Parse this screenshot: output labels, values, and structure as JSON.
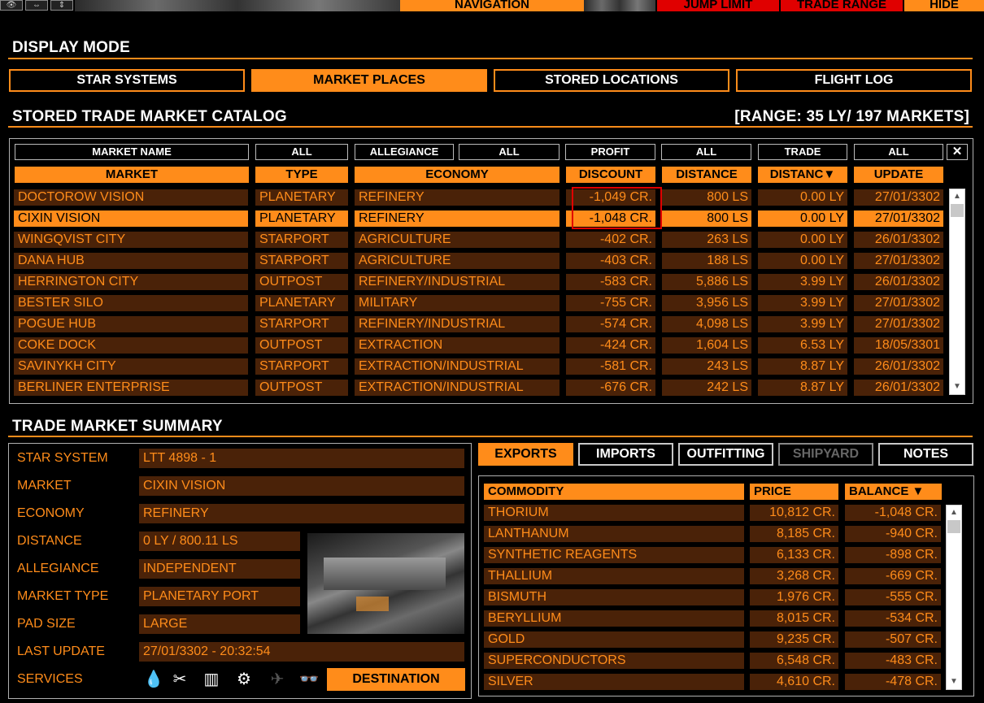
{
  "topbar": {
    "icons": [
      "eye-icon",
      "horizontal-arrows-icon",
      "vertical-arrows-icon"
    ],
    "navigation": "NAVIGATION",
    "jump_limit": "JUMP LIMIT",
    "trade_range": "TRADE RANGE",
    "hide": "HIDE"
  },
  "display_mode": {
    "title": "DISPLAY MODE",
    "buttons": [
      "STAR SYSTEMS",
      "MARKET PLACES",
      "STORED LOCATIONS",
      "FLIGHT LOG"
    ],
    "active": "MARKET PLACES"
  },
  "catalog": {
    "title": "STORED TRADE MARKET CATALOG",
    "range": "[RANGE: 35 LY/ 197 MARKETS]",
    "filters": {
      "market_name": "MARKET NAME",
      "type": "ALL",
      "allegiance_label": "ALLEGIANCE",
      "allegiance": "ALL",
      "profit_label": "PROFIT",
      "profit": "ALL",
      "trade_label": "TRADE",
      "trade": "ALL",
      "clear": "✕"
    },
    "columns": [
      "MARKET",
      "TYPE",
      "ECONOMY",
      "DISCOUNT",
      "DISTANCE",
      "DISTANC▼",
      "UPDATE"
    ],
    "rows": [
      {
        "market": "DOCTOROW VISION",
        "type": "PLANETARY",
        "economy": "REFINERY",
        "discount": "-1,049 CR.",
        "distance": "800 LS",
        "ly": "0.00 LY",
        "update": "27/01/3302"
      },
      {
        "market": "CIXIN VISION",
        "type": "PLANETARY",
        "economy": "REFINERY",
        "discount": "-1,048 CR.",
        "distance": "800 LS",
        "ly": "0.00 LY",
        "update": "27/01/3302"
      },
      {
        "market": "WINGQVIST CITY",
        "type": "STARPORT",
        "economy": "AGRICULTURE",
        "discount": "-402 CR.",
        "distance": "263 LS",
        "ly": "0.00 LY",
        "update": "26/01/3302"
      },
      {
        "market": "DANA HUB",
        "type": "STARPORT",
        "economy": "AGRICULTURE",
        "discount": "-403 CR.",
        "distance": "188 LS",
        "ly": "0.00 LY",
        "update": "27/01/3302"
      },
      {
        "market": "HERRINGTON CITY",
        "type": "OUTPOST",
        "economy": "REFINERY/INDUSTRIAL",
        "discount": "-583 CR.",
        "distance": "5,886 LS",
        "ly": "3.99 LY",
        "update": "26/01/3302"
      },
      {
        "market": "BESTER SILO",
        "type": "PLANETARY",
        "economy": "MILITARY",
        "discount": "-755 CR.",
        "distance": "3,956 LS",
        "ly": "3.99 LY",
        "update": "27/01/3302"
      },
      {
        "market": "POGUE HUB",
        "type": "STARPORT",
        "economy": "REFINERY/INDUSTRIAL",
        "discount": "-574 CR.",
        "distance": "4,098 LS",
        "ly": "3.99 LY",
        "update": "27/01/3302"
      },
      {
        "market": "COKE DOCK",
        "type": "OUTPOST",
        "economy": "EXTRACTION",
        "discount": "-424 CR.",
        "distance": "1,604 LS",
        "ly": "6.53 LY",
        "update": "18/05/3301"
      },
      {
        "market": "SAVINYKH CITY",
        "type": "STARPORT",
        "economy": "EXTRACTION/INDUSTRIAL",
        "discount": "-581 CR.",
        "distance": "243 LS",
        "ly": "8.87 LY",
        "update": "26/01/3302"
      },
      {
        "market": "BERLINER ENTERPRISE",
        "type": "OUTPOST",
        "economy": "EXTRACTION/INDUSTRIAL",
        "discount": "-676 CR.",
        "distance": "242 LS",
        "ly": "8.87 LY",
        "update": "26/01/3302"
      }
    ],
    "selected_index": 1,
    "highlight_color": "#e00000"
  },
  "summary": {
    "title": "TRADE MARKET SUMMARY",
    "fields": [
      {
        "label": "STAR SYSTEM",
        "value": "LTT 4898 - 1"
      },
      {
        "label": "MARKET",
        "value": "CIXIN VISION"
      },
      {
        "label": "ECONOMY",
        "value": "REFINERY"
      },
      {
        "label": "DISTANCE",
        "value": "0 LY / 800.11 LS"
      },
      {
        "label": "ALLEGIANCE",
        "value": "INDEPENDENT"
      },
      {
        "label": "MARKET TYPE",
        "value": "PLANETARY PORT"
      },
      {
        "label": "PAD SIZE",
        "value": "LARGE"
      },
      {
        "label": "LAST UPDATE",
        "value": "27/01/3302 - 20:32:54"
      },
      {
        "label": "SERVICES",
        "value": ""
      }
    ],
    "services_icons": [
      "refuel-drop-icon",
      "repair-tools-icon",
      "black-market-icon",
      "outfitting-gear-icon",
      "shipyard-ship-icon",
      "disguise-glasses-icon"
    ],
    "destination": "DESTINATION",
    "image": "station-image"
  },
  "tabs": {
    "labels": [
      "EXPORTS",
      "IMPORTS",
      "OUTFITTING",
      "SHIPYARD",
      "NOTES"
    ],
    "active": "EXPORTS",
    "disabled": "SHIPYARD"
  },
  "commodities": {
    "columns": [
      "COMMODITY",
      "PRICE",
      "BALANCE ▼"
    ],
    "rows": [
      {
        "name": "THORIUM",
        "price": "10,812 CR.",
        "balance": "-1,048 CR."
      },
      {
        "name": "LANTHANUM",
        "price": "8,185 CR.",
        "balance": "-940 CR."
      },
      {
        "name": "SYNTHETIC REAGENTS",
        "price": "6,133 CR.",
        "balance": "-898 CR."
      },
      {
        "name": "THALLIUM",
        "price": "3,268 CR.",
        "balance": "-669 CR."
      },
      {
        "name": "BISMUTH",
        "price": "1,976 CR.",
        "balance": "-555 CR."
      },
      {
        "name": "BERYLLIUM",
        "price": "8,015 CR.",
        "balance": "-534 CR."
      },
      {
        "name": "GOLD",
        "price": "9,235 CR.",
        "balance": "-507 CR."
      },
      {
        "name": "SUPERCONDUCTORS",
        "price": "6,548 CR.",
        "balance": "-483 CR."
      },
      {
        "name": "SILVER",
        "price": "4,610 CR.",
        "balance": "-478 CR."
      }
    ]
  },
  "colors": {
    "accent": "#ff8c1a",
    "row_bg": "#4a2208",
    "alert": "#e00000"
  }
}
